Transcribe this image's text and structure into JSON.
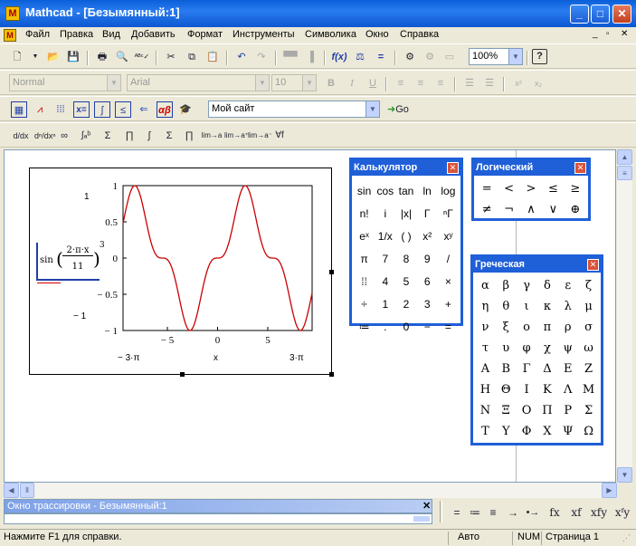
{
  "window": {
    "title": "Mathcad - [Безымянный:1]",
    "app_icon": "M"
  },
  "menu": [
    "Файл",
    "Правка",
    "Вид",
    "Добавить",
    "Формат",
    "Инструменты",
    "Символика",
    "Окно",
    "Справка"
  ],
  "toolbar": {
    "zoom": "100%"
  },
  "format_bar": {
    "style": "Normal",
    "font": "Arial",
    "size": "10"
  },
  "math_bar": {
    "site": "Мой сайт",
    "go": "Go"
  },
  "calculus_bar": [
    "d/dx",
    "dⁿ/dxⁿ",
    "∞",
    "∫ₐᵇ",
    "Σ",
    "∏",
    "∫",
    "Σ",
    "∏",
    "lim→a",
    "lim→a⁺",
    "lim→a⁻",
    "∀f"
  ],
  "plot": {
    "y_axis_label_top": "1",
    "y_axis_label_bottom": "− 1",
    "expression": {
      "func": "sin",
      "num": "2·π·x",
      "den": "11",
      "power": "3"
    },
    "x_axis_label": "x",
    "x_min_label": "− 3·π",
    "x_max_label": "3·π",
    "y_ticks": [
      "1",
      "0.5",
      "0",
      "− 0.5",
      "− 1"
    ],
    "x_ticks": [
      "− 5",
      "0",
      "5"
    ],
    "line_color": "#cc0000"
  },
  "chart_data": {
    "type": "line",
    "title": "",
    "xlabel": "x",
    "ylabel": "",
    "xlim": [
      -9.42,
      9.42
    ],
    "ylim": [
      -1,
      1
    ],
    "series": [
      {
        "name": "",
        "func": "sin(2πx/11)^3",
        "values_sample_x": [
          -9.42,
          -5,
          0,
          5,
          9.42
        ],
        "values_sample_y": [
          0.35,
          -0.98,
          0,
          0.98,
          -0.35
        ]
      }
    ],
    "grid": false,
    "legend": "none"
  },
  "calculator": {
    "title": "Калькулятор",
    "keys": [
      "sin",
      "cos",
      "tan",
      "ln",
      "log",
      "n!",
      "i",
      "|x|",
      "Γ",
      "ⁿΓ",
      "eˣ",
      "1/x",
      "( )",
      "x²",
      "xʸ",
      "π",
      "7",
      "8",
      "9",
      "/",
      "⁞⁞",
      "4",
      "5",
      "6",
      "×",
      "÷",
      "1",
      "2",
      "3",
      "+",
      "≔",
      ".",
      "0",
      "−",
      "="
    ]
  },
  "logic": {
    "title": "Логический",
    "keys": [
      "=",
      "<",
      ">",
      "≤",
      "≥",
      "≠",
      "¬",
      "∧",
      "∨",
      "⊕"
    ]
  },
  "greek": {
    "title": "Греческая",
    "keys": [
      "α",
      "β",
      "γ",
      "δ",
      "ε",
      "ζ",
      "η",
      "θ",
      "ι",
      "κ",
      "λ",
      "μ",
      "ν",
      "ξ",
      "ο",
      "π",
      "ρ",
      "σ",
      "τ",
      "υ",
      "φ",
      "χ",
      "ψ",
      "ω",
      "Α",
      "Β",
      "Γ",
      "Δ",
      "Ε",
      "Ζ",
      "Η",
      "Θ",
      "Ι",
      "Κ",
      "Λ",
      "Μ",
      "Ν",
      "Ξ",
      "Ο",
      "Π",
      "Ρ",
      "Σ",
      "Τ",
      "Υ",
      "Φ",
      "Χ",
      "Ψ",
      "Ω"
    ]
  },
  "trace": {
    "title": "Окно трассировки - Безымянный:1"
  },
  "symbolic_bar": [
    "=",
    "≔",
    "≡",
    "→",
    "•→",
    "fx",
    "xf",
    "xfy",
    "xᶠy"
  ],
  "status": {
    "hint": "Нажмите F1 для справки.",
    "mode": "Авто",
    "num": "NUM",
    "page": "Страница 1"
  }
}
